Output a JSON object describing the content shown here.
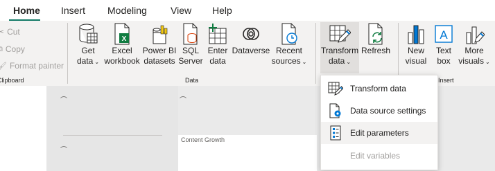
{
  "tabs": [
    {
      "label": "Home",
      "active": true
    },
    {
      "label": "Insert"
    },
    {
      "label": "Modeling"
    },
    {
      "label": "View"
    },
    {
      "label": "Help"
    }
  ],
  "clipboard": {
    "cut": "Cut",
    "copy": "Copy",
    "format_painter": "Format painter",
    "group_label": "Clipboard"
  },
  "data_group": {
    "get_data": [
      "Get",
      "data"
    ],
    "excel": [
      "Excel",
      "workbook"
    ],
    "pbi": [
      "Power BI",
      "datasets"
    ],
    "sql": [
      "SQL",
      "Server"
    ],
    "enter": [
      "Enter",
      "data"
    ],
    "dataverse": "Dataverse",
    "recent": [
      "Recent",
      "sources"
    ],
    "group_label": "Data"
  },
  "queries_group": {
    "transform": [
      "Transform",
      "data"
    ],
    "refresh": "Refresh"
  },
  "insert_group": {
    "new_visual": [
      "New",
      "visual"
    ],
    "text_box": [
      "Text",
      "box"
    ],
    "more_visuals": [
      "More",
      "visuals"
    ],
    "group_label": "Insert"
  },
  "canvas": {
    "visual_title": "Content Growth"
  },
  "dropdown": {
    "items": [
      {
        "label": "Transform data",
        "icon": "transform-data-icon"
      },
      {
        "label": "Data source settings",
        "icon": "data-source-settings-icon"
      },
      {
        "label": "Edit parameters",
        "icon": "edit-parameters-icon",
        "highlighted": true
      },
      {
        "label": "Edit variables",
        "disabled": true
      }
    ]
  },
  "colors": {
    "accent": "#117865",
    "excel_green": "#107c41",
    "icon_blue": "#0078d4"
  }
}
